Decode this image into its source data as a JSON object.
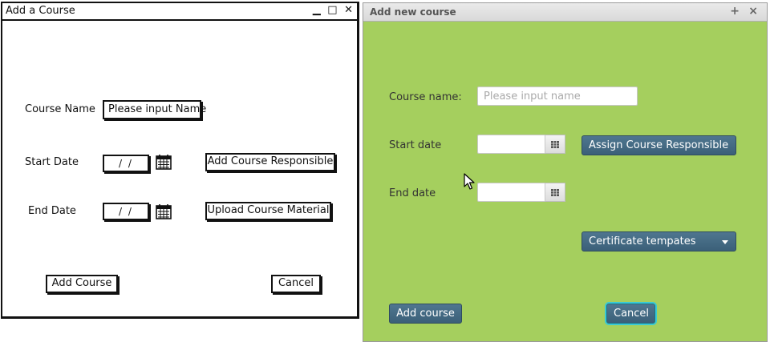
{
  "sketch": {
    "title": "Add a Course",
    "controls": [
      "▁",
      "□",
      "✕"
    ],
    "course_name_label": "Course Name",
    "course_name_value": "Please input Name",
    "start_date_label": "Start Date",
    "start_date_value": "/ /",
    "end_date_label": "End Date",
    "end_date_value": "/ /",
    "assign_button": "Add Course Responsible",
    "upload_button": "Upload Course Material",
    "add_button": "Add Course",
    "cancel_button": "Cancel",
    "calendar_icon": "calendar-icon"
  },
  "fx": {
    "title": "Add new course",
    "maximize": "+",
    "close": "×",
    "course_name_label": "Course name:",
    "course_name_placeholder": "Please input name",
    "start_date_label": "Start date",
    "end_date_label": "End date",
    "assign_button": "Assign Course Responsible",
    "certificate_combo": "Certificate tempates",
    "add_button": "Add course",
    "cancel_button": "Cancel",
    "background": "#a5cf5e",
    "button_color": "#3f6680",
    "focus_color": "#39c9d6"
  }
}
